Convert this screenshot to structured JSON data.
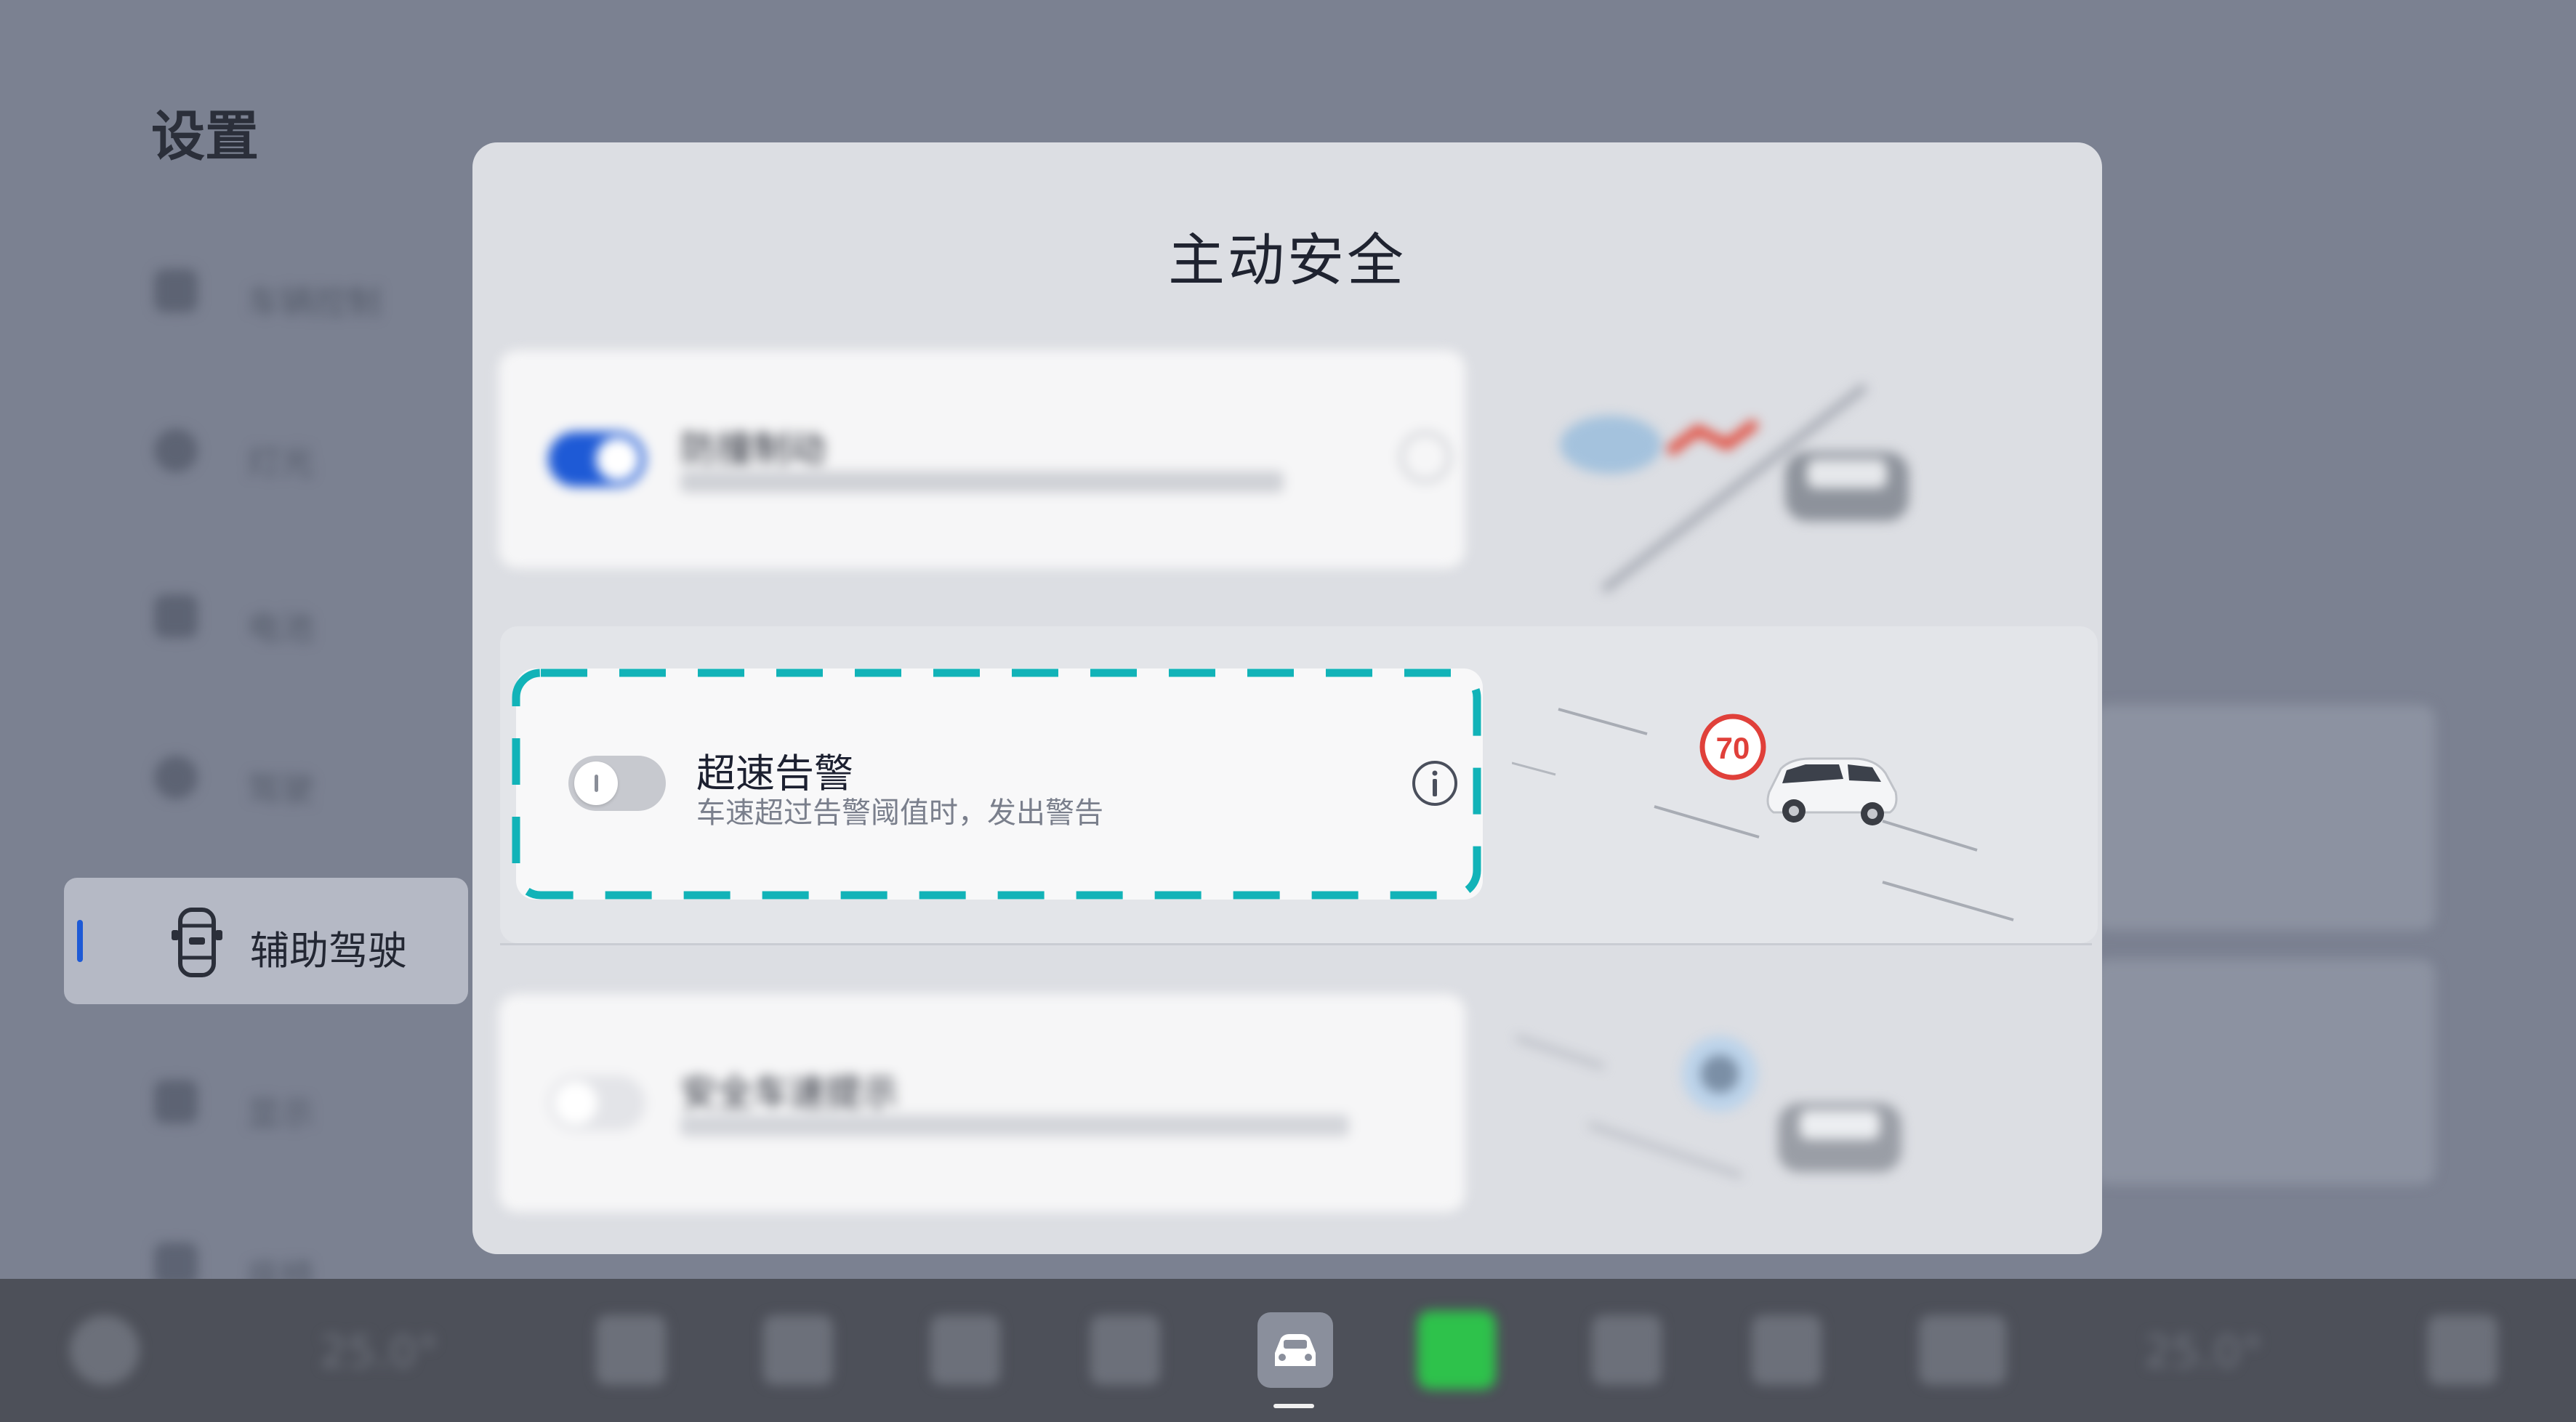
{
  "sidebar": {
    "title": "设置",
    "items": [
      {
        "label": "车辆控制",
        "icon": "car-control-icon"
      },
      {
        "label": "灯光",
        "icon": "light-icon"
      },
      {
        "label": "电池",
        "icon": "battery-icon"
      },
      {
        "label": "驾驶",
        "icon": "steering-icon"
      },
      {
        "label": "辅助驾驶",
        "icon": "assisted-driving-icon",
        "active": true
      },
      {
        "label": "显示",
        "icon": "display-icon"
      },
      {
        "label": "座椅",
        "icon": "seat-icon"
      }
    ]
  },
  "modal": {
    "title": "主动安全",
    "rows": [
      {
        "title": "防撞制动",
        "desc": "",
        "toggle_on": true
      },
      {
        "title": "超速告警",
        "desc": "车速超过告警阈值时，发出警告",
        "toggle_on": false,
        "speed_limit_sign": "70"
      },
      {
        "title": "安全车速提示",
        "desc": "",
        "toggle_on": false
      }
    ]
  },
  "dock": {
    "left_temp": "25.0°",
    "right_temp": "25.0°",
    "active_app": "car-icon"
  },
  "colors": {
    "accent_blue": "#1e5ad6",
    "highlight_dash": "#12b3b8",
    "speed_sign_red": "#e0403a",
    "phone_green": "#2ec24b"
  }
}
